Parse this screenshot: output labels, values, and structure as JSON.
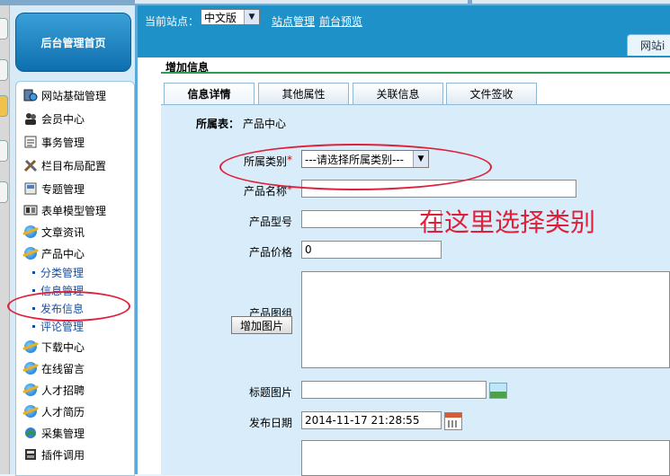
{
  "header": {
    "site_label": "当前站点：",
    "site_value": "中文版",
    "links": [
      "站点管理",
      "前台预览"
    ],
    "site_tab": "网站i"
  },
  "sidebar": {
    "home_button": "后台管理首页",
    "items": [
      {
        "label": "网站基础管理",
        "icon": "globe-server-icon"
      },
      {
        "label": "会员中心",
        "icon": "users-icon"
      },
      {
        "label": "事务管理",
        "icon": "tasks-icon"
      },
      {
        "label": "栏目布局配置",
        "icon": "tools-icon"
      },
      {
        "label": "专题管理",
        "icon": "topic-icon"
      },
      {
        "label": "表单模型管理",
        "icon": "form-icon"
      },
      {
        "label": "文章资讯",
        "icon": "ie-icon"
      },
      {
        "label": "产品中心",
        "icon": "ie-icon"
      },
      {
        "label": "下载中心",
        "icon": "ie-icon"
      },
      {
        "label": "在线留言",
        "icon": "ie-icon"
      },
      {
        "label": "人才招聘",
        "icon": "ie-icon"
      },
      {
        "label": "人才简历",
        "icon": "ie-icon"
      },
      {
        "label": "采集管理",
        "icon": "collect-icon"
      },
      {
        "label": "插件调用",
        "icon": "plugin-icon"
      }
    ],
    "sub_items": [
      "分类管理",
      "信息管理",
      "发布信息",
      "评论管理"
    ]
  },
  "content": {
    "title": "增加信息",
    "tabs": [
      "信息详情",
      "其他属性",
      "关联信息",
      "文件签收"
    ],
    "table_label": "所属表：",
    "table_value": "产品中心",
    "fields": {
      "category_label": "所属类别",
      "category_placeholder": "---请选择所属类别---",
      "name_label": "产品名称",
      "model_label": "产品型号",
      "price_label": "产品价格",
      "price_value": "0",
      "gallery_label": "产品图组",
      "add_image_button": "增加图片",
      "title_image_label": "标题图片",
      "date_label": "发布日期",
      "date_value": "2014-11-17 21:28:55"
    },
    "required_mark": "*"
  },
  "annotation": {
    "text": "在这里选择类别",
    "color": "#e0203a"
  }
}
